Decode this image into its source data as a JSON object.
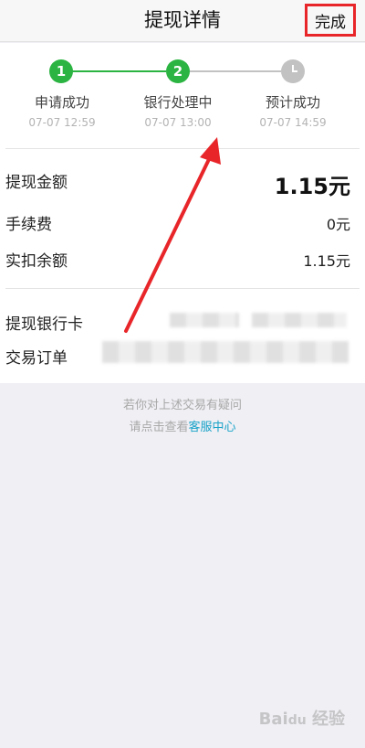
{
  "navbar": {
    "title": "提现详情",
    "done_label": "完成"
  },
  "steps": [
    {
      "index": "1",
      "label": "申请成功",
      "time": "07-07 12:59",
      "status": "done"
    },
    {
      "index": "2",
      "label": "银行处理中",
      "time": "07-07 13:00",
      "status": "current"
    },
    {
      "index": "",
      "label": "预计成功",
      "time": "07-07 14:59",
      "status": "pending"
    }
  ],
  "details": {
    "amount_label": "提现金额",
    "amount_value": "1.15元",
    "fee_label": "手续费",
    "fee_value": "0元",
    "deduct_label": "实扣余额",
    "deduct_value": "1.15元",
    "card_label": "提现银行卡",
    "order_label": "交易订单"
  },
  "help": {
    "line1": "若你对上述交易有疑问",
    "line2_prefix": "请点击查看",
    "line2_link": "客服中心"
  },
  "colors": {
    "green": "#2bb441",
    "grey": "#c2c2c2",
    "link": "#1aa3c8",
    "highlight": "#e8262a"
  },
  "icons": {
    "pending_step": "clock-icon"
  }
}
